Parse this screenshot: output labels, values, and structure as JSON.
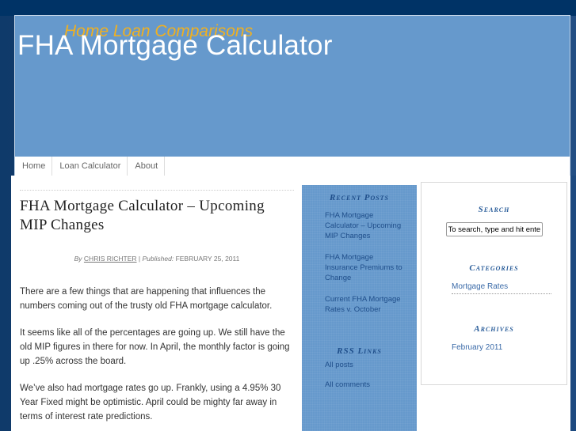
{
  "header": {
    "tagline": "Home Loan Comparisons",
    "site_title": "FHA Mortgage Calculator"
  },
  "nav": {
    "items": [
      {
        "label": "Home"
      },
      {
        "label": "Loan Calculator"
      },
      {
        "label": "About"
      }
    ]
  },
  "post": {
    "title": "FHA Mortgage Calculator – Upcoming MIP Changes",
    "byline": {
      "by_label": "By",
      "author": "CHRIS RICHTER",
      "separator": "|",
      "published_label": "Published:",
      "date": "FEBRUARY 25, 2011"
    },
    "paragraphs": [
      "There are a few things that are happening that influences the numbers coming out of the trusty old FHA mortgage calculator.",
      "It seems like all of the percentages are going up.  We still have the old MIP figures in there for now.  In April, the monthly factor is going up .25% across the board.",
      "We’ve also had mortgage rates go up.  Frankly, using a 4.95% 30 Year Fixed might be optimistic.  April could be mighty far away in terms of interest rate predictions."
    ]
  },
  "sidebar_recent": {
    "title": "Recent Posts",
    "items": [
      {
        "label": "FHA Mortgage Calculator – Upcoming MIP Changes"
      },
      {
        "label": "FHA Mortgage Insurance Premiums to Change"
      },
      {
        "label": "Current FHA Mortgage Rates v. October"
      }
    ],
    "rss_title": "RSS Links",
    "rss_items": [
      {
        "label": "All posts"
      },
      {
        "label": "All comments"
      }
    ]
  },
  "sidebar_right": {
    "search_title": "Search",
    "search_value": "To search, type and hit enter",
    "categories_title": "Categories",
    "categories": [
      {
        "label": "Mortgage Rates"
      }
    ],
    "archives_title": "Archives",
    "archives": [
      {
        "label": "February 2011"
      }
    ]
  },
  "colors": {
    "header_bg": "#6699cc",
    "page_bg": "#003366",
    "tagline": "#f0b020",
    "link": "#1f4e8a"
  }
}
